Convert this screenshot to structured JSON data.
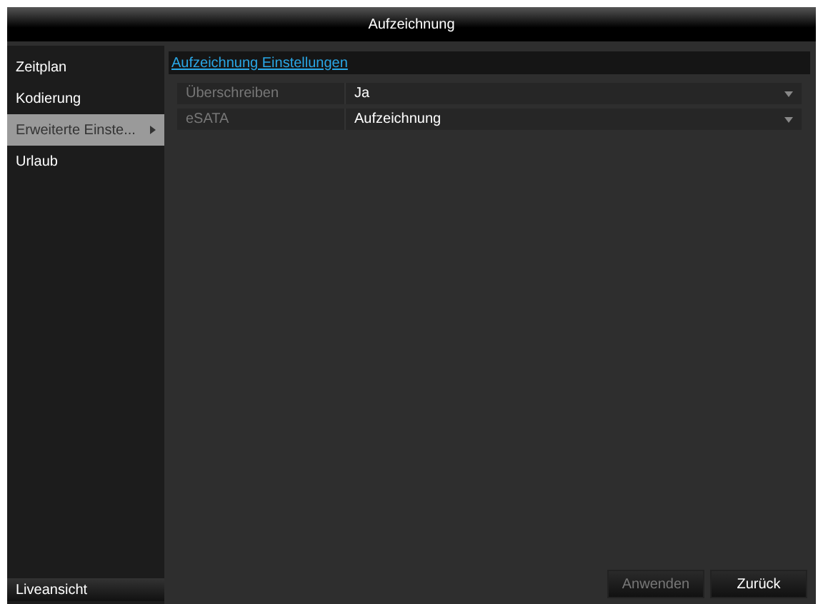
{
  "window": {
    "title": "Aufzeichnung"
  },
  "sidebar": {
    "items": [
      {
        "label": "Zeitplan",
        "selected": false
      },
      {
        "label": "Kodierung",
        "selected": false
      },
      {
        "label": "Erweiterte Einste...",
        "selected": true
      },
      {
        "label": "Urlaub",
        "selected": false
      }
    ],
    "footer": "Liveansicht"
  },
  "section": {
    "title": "Aufzeichnung Einstellungen"
  },
  "settings": [
    {
      "label": "Überschreiben",
      "value": "Ja"
    },
    {
      "label": "eSATA",
      "value": "Aufzeichnung"
    }
  ],
  "buttons": [
    {
      "label": "Anwenden",
      "disabled": true
    },
    {
      "label": "Zurück",
      "disabled": false
    }
  ]
}
